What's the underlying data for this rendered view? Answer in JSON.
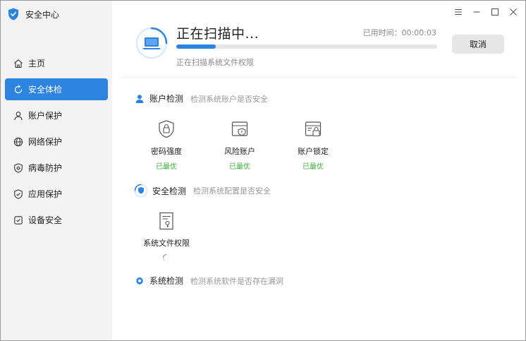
{
  "app": {
    "title": "安全中心"
  },
  "sidebar": {
    "items": [
      {
        "label": "主页",
        "icon": "home-icon",
        "active": false
      },
      {
        "label": "安全体检",
        "icon": "refresh-icon",
        "active": true
      },
      {
        "label": "账户保护",
        "icon": "user-icon",
        "active": false
      },
      {
        "label": "网络保护",
        "icon": "globe-icon",
        "active": false
      },
      {
        "label": "病毒防护",
        "icon": "virus-shield-icon",
        "active": false
      },
      {
        "label": "应用保护",
        "icon": "app-shield-icon",
        "active": false
      },
      {
        "label": "设备安全",
        "icon": "device-check-icon",
        "active": false
      }
    ]
  },
  "scan": {
    "title": "正在扫描中...",
    "elapsed_label": "已用时间：00:00:03",
    "progress": 0.15,
    "subtitle": "正在扫描系统文件权限",
    "cancel_label": "取消"
  },
  "sections": {
    "account": {
      "title": "账户检测",
      "desc": "检测系统账户是否安全",
      "items": [
        {
          "label": "密码强度",
          "status": "已最优",
          "icon": "password-shield-icon"
        },
        {
          "label": "风险账户",
          "status": "已最优",
          "icon": "risk-account-icon"
        },
        {
          "label": "账户锁定",
          "status": "已最优",
          "icon": "account-lock-icon"
        }
      ]
    },
    "security": {
      "title": "安全检测",
      "desc": "检测系统配置是否安全",
      "items": [
        {
          "label": "系统文件权限",
          "icon": "file-permission-icon"
        }
      ]
    },
    "system": {
      "title": "系统检测",
      "desc": "检测系统软件是否存在漏洞"
    }
  },
  "colors": {
    "accent": "#2d84e0",
    "success": "#3dae3c",
    "sidebar_bg": "#f3f3f3"
  }
}
